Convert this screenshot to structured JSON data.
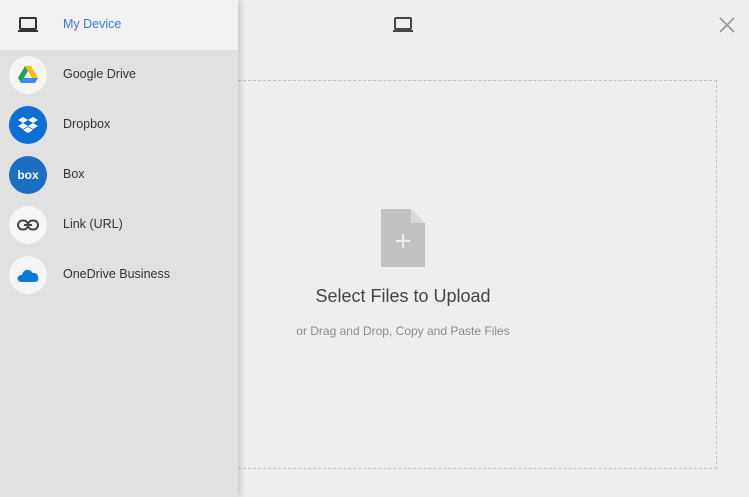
{
  "sidebar": {
    "items": [
      {
        "label": "My Device",
        "icon": "laptop-icon",
        "active": true
      },
      {
        "label": "Google Drive",
        "icon": "google-drive-icon"
      },
      {
        "label": "Dropbox",
        "icon": "dropbox-icon"
      },
      {
        "label": "Box",
        "icon": "box-icon"
      },
      {
        "label": "Link (URL)",
        "icon": "link-icon"
      },
      {
        "label": "OneDrive Business",
        "icon": "onedrive-icon"
      }
    ]
  },
  "header": {
    "device_icon": "laptop-icon",
    "close_icon": "close-icon"
  },
  "dropzone": {
    "title": "Select Files to Upload",
    "subtitle": "or Drag and Drop, Copy and Paste Files"
  },
  "colors": {
    "accent": "#3a7ad9",
    "sidebar_bg": "#e1e1e1",
    "main_bg": "#eeeeee",
    "dropbox_blue": "#0d6ed5",
    "box_blue": "#1a6fc2"
  }
}
